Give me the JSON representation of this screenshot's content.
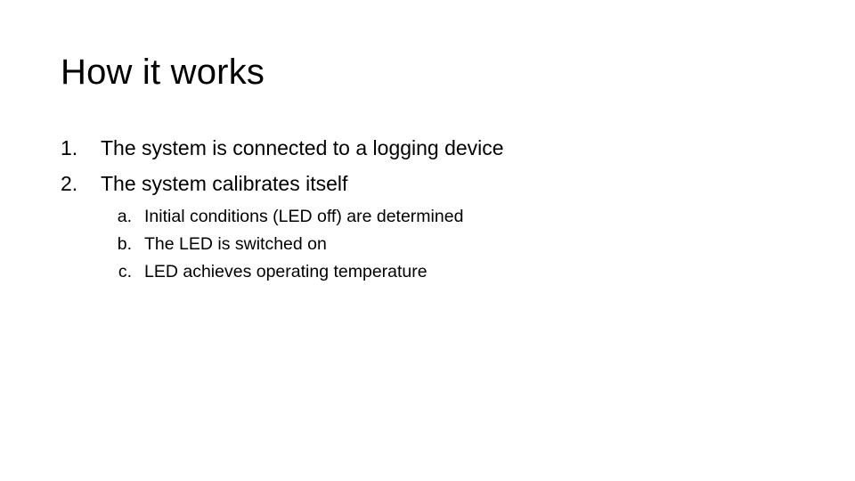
{
  "slide": {
    "title": "How it works",
    "background_color": "#ffffff",
    "text_color": "#000000",
    "outline": [
      {
        "marker": "1.",
        "text": "The system is connected to a logging device",
        "subitems": []
      },
      {
        "marker": "2.",
        "text": "The system calibrates itself",
        "subitems": [
          {
            "marker": "a.",
            "text": "Initial conditions (LED off) are determined"
          },
          {
            "marker": "b.",
            "text": "The LED is switched on"
          },
          {
            "marker": "c.",
            "text": "LED achieves operating temperature"
          }
        ]
      }
    ]
  }
}
